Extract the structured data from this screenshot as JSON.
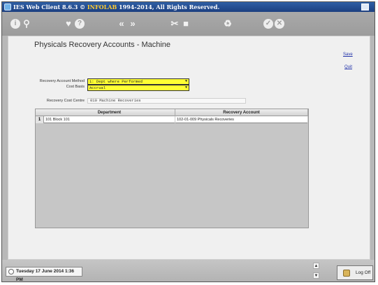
{
  "titlebar": {
    "app_name": "IES Web Client 8.6.3",
    "copyright_symbol": "©",
    "company": "INFOLAB",
    "rights": "1994-2014, All Rights Reserved."
  },
  "toolbar": {
    "icons": [
      "info-icon",
      "search-icon",
      "favorite-icon",
      "help-icon",
      "prev-icon",
      "next-icon",
      "tools-icon",
      "stop-icon",
      "recycle-icon",
      "ok-icon",
      "cancel-icon"
    ]
  },
  "page": {
    "title": "Physicals Recovery Accounts - Machine",
    "save_label": "Save",
    "quit_label": "Quit"
  },
  "form": {
    "recovery_method_label": "Recovery Account Method",
    "recovery_method_value": "1: Dept where Performed",
    "cost_basis_label": "Cost Basis",
    "cost_basis_value": "Accrual",
    "cost_centre_label": "Recovery Cost Centre",
    "cost_centre_value": "010 Machine Recoveries"
  },
  "grid": {
    "columns": [
      "Department",
      "Recovery Account"
    ],
    "rows": [
      {
        "num": "1",
        "department": "101 Block 101",
        "recovery_account": "102-01-009 Physicals Recoveries"
      }
    ]
  },
  "status": {
    "datetime": "Tuesday 17 June 2014 1:36 PM",
    "logoff_label": "Log Off"
  },
  "colors": {
    "titlebar": "#1c3f80",
    "select_bg": "#ffff33",
    "link": "#2233aa"
  }
}
